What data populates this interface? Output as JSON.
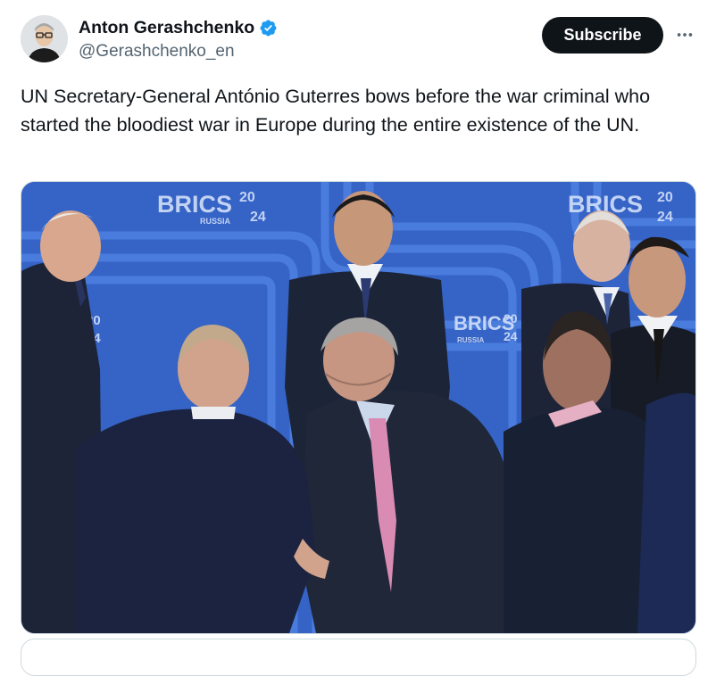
{
  "author": {
    "display_name": "Anton Gerashchenko",
    "handle": "@Gerashchenko_en",
    "verified_icon": "verified-badge-icon",
    "verified_color": "#1d9bf0"
  },
  "actions": {
    "subscribe_label": "Subscribe",
    "more_icon": "more-horizontal-icon"
  },
  "tweet": {
    "text": "UN Secretary-General António Guterres bows before the war criminal who started the bloodiest war in Europe during the entire existence of the UN."
  },
  "media": {
    "background_logo_main": "BRICS",
    "background_logo_year_top": "20",
    "background_logo_year_bottom": "24",
    "background_logo_country": "RUSSIA",
    "colors": {
      "backdrop": "#3563c6",
      "stripe": "#4d7fe0",
      "suit": "#1c2438",
      "tie_pink": "#d98bb3"
    }
  }
}
